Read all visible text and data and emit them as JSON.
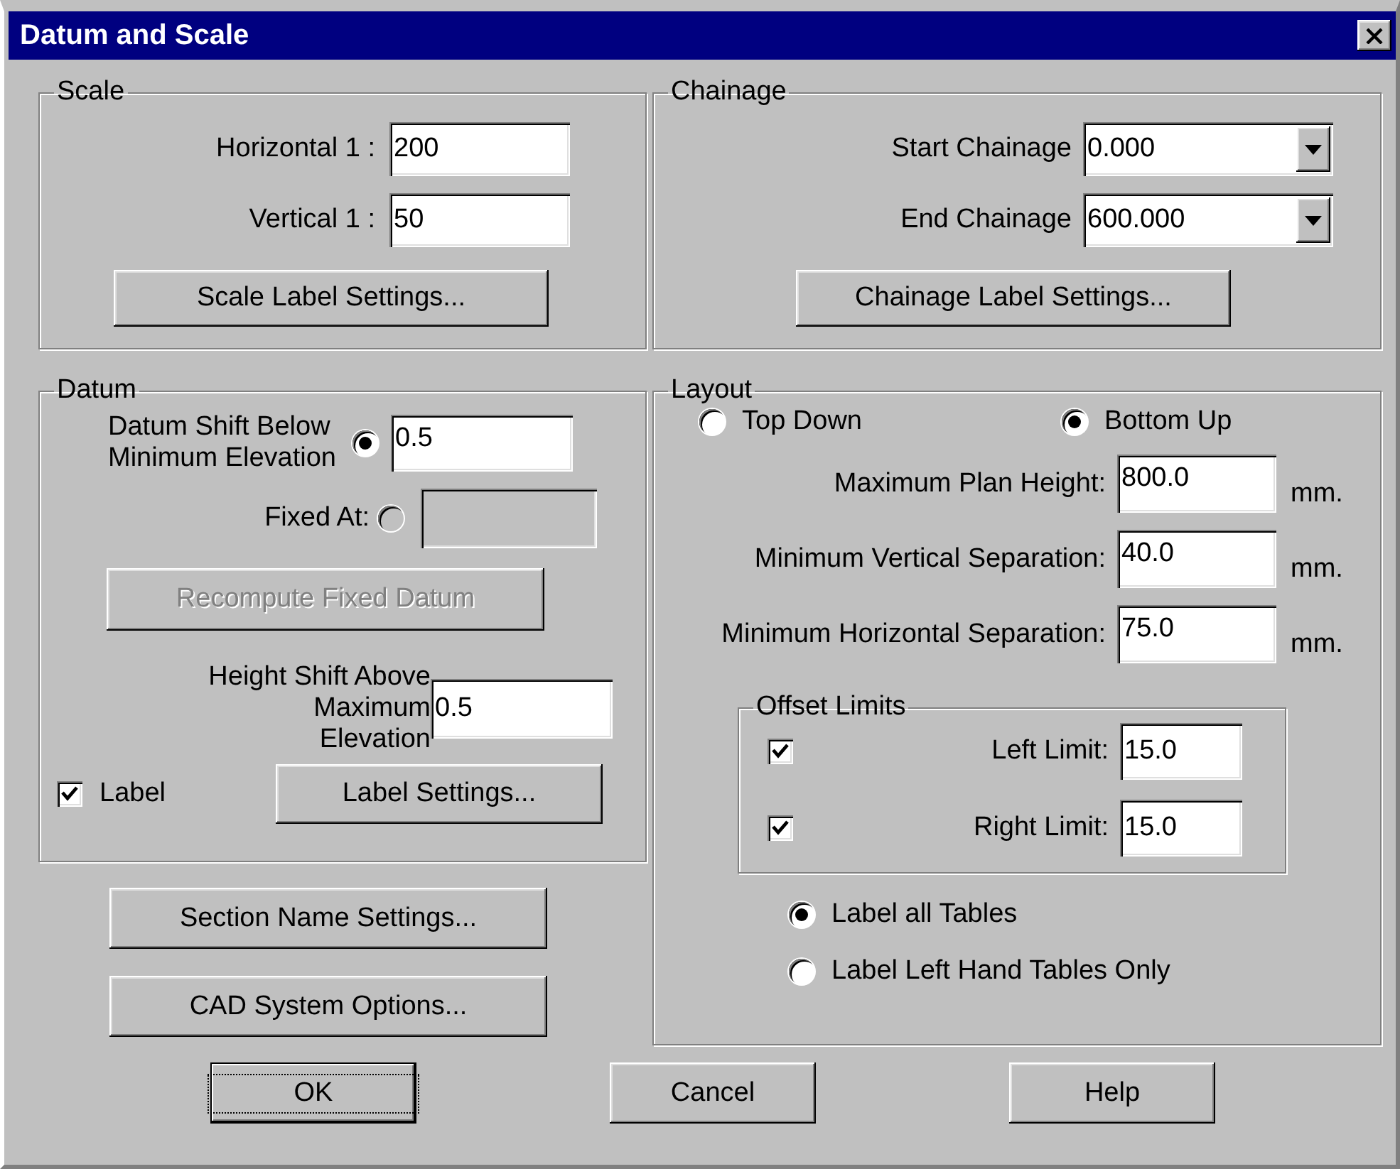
{
  "window": {
    "title": "Datum and Scale"
  },
  "scale": {
    "title": "Scale",
    "fields": [
      {
        "label": "Horizontal 1 :",
        "value": "200"
      },
      {
        "label": "Vertical 1 :",
        "value": "50"
      }
    ],
    "button": "Scale Label Settings..."
  },
  "chainage": {
    "title": "Chainage",
    "fields": [
      {
        "label": "Start Chainage",
        "value": "0.000"
      },
      {
        "label": "End Chainage",
        "value": "600.000"
      }
    ],
    "button": "Chainage Label Settings..."
  },
  "datum": {
    "title": "Datum",
    "options": [
      {
        "label": "Datum Shift Below Minimum Elevation",
        "selected": true,
        "value": "0.5",
        "disabled": false
      },
      {
        "label": "Fixed At:",
        "selected": false,
        "disabled": true
      }
    ],
    "recompute_button": {
      "label": "Recompute Fixed Datum",
      "disabled": true
    },
    "height_shift": {
      "label": "Height Shift Above Maximum Elevation",
      "value": "0.5"
    },
    "label_checkbox": {
      "label": "Label",
      "checked": true
    },
    "label_button": "Label Settings..."
  },
  "section_button": "Section Name Settings...",
  "cad_button": "CAD System Options...",
  "layout": {
    "title": "Layout",
    "directions": [
      {
        "label": "Top Down",
        "selected": false
      },
      {
        "label": "Bottom Up",
        "selected": true
      }
    ],
    "fields": [
      {
        "label": "Maximum Plan Height:",
        "value": "800.0",
        "unit": "mm."
      },
      {
        "label": "Minimum Vertical Separation:",
        "value": "40.0",
        "unit": "mm."
      },
      {
        "label": "Minimum Horizontal Separation:",
        "value": "75.0",
        "unit": "mm."
      }
    ],
    "offset_limits": {
      "title": "Offset Limits",
      "rows": [
        {
          "label": "Left Limit:",
          "checked": true,
          "value": "15.0"
        },
        {
          "label": "Right Limit:",
          "checked": true,
          "value": "15.0"
        }
      ]
    },
    "table_labels": [
      {
        "label": "Label all Tables",
        "selected": true
      },
      {
        "label": "Label Left Hand Tables Only",
        "selected": false
      }
    ]
  },
  "buttons": [
    {
      "label": "OK",
      "default": true
    },
    {
      "label": "Cancel",
      "default": false
    },
    {
      "label": "Help",
      "default": false
    }
  ]
}
